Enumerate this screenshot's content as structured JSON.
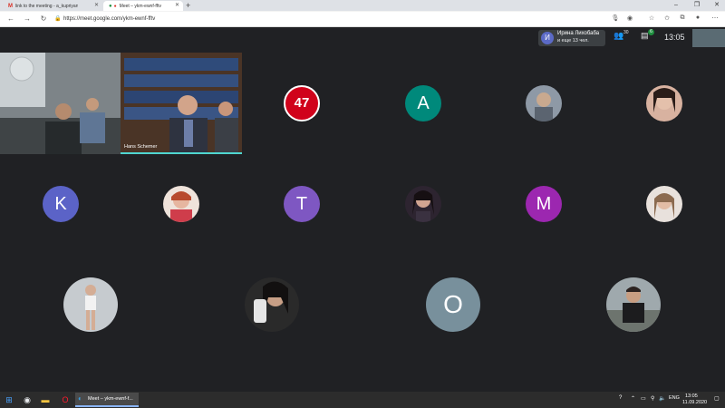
{
  "browser": {
    "tabs": [
      {
        "label": "link to the meeting - a_kupriyan",
        "icon": "gmail-icon"
      },
      {
        "label": "Meet – ykm-ewnf-fftv",
        "icon": "meet-icon",
        "active": true
      }
    ],
    "new_tab": "+",
    "url": "https://meet.google.com/ykm-ewnf-fftv",
    "window_controls": [
      "–",
      "❐",
      "✕"
    ]
  },
  "meet": {
    "presenter": {
      "initial": "И",
      "name": "Ирина Лихобаба",
      "others": "и еще 13 чел."
    },
    "participants_count": "30",
    "chat_badge": "6",
    "clock": "13:05",
    "tiles": [
      {
        "name": "",
        "type": "video"
      },
      {
        "name": "Hans Schemer",
        "type": "video"
      },
      {
        "label": "47",
        "type": "badge",
        "color": "#d0021b"
      },
      {
        "label": "A",
        "type": "initial",
        "color": "#00897b"
      },
      {
        "type": "photo"
      },
      {
        "type": "photo"
      },
      {
        "label": "K",
        "type": "initial",
        "color": "#5b63c7"
      },
      {
        "type": "photo"
      },
      {
        "label": "T",
        "type": "initial",
        "color": "#7e57c2"
      },
      {
        "type": "photo"
      },
      {
        "label": "M",
        "type": "initial",
        "color": "#9c27b0"
      },
      {
        "type": "photo"
      },
      {
        "type": "photo"
      },
      {
        "type": "photo"
      },
      {
        "label": "O",
        "type": "initial",
        "color": "#78909c"
      },
      {
        "type": "photo"
      }
    ]
  },
  "taskbar": {
    "app_label": "Meet – ykm-ewnf-f...",
    "lang": "ENG",
    "time": "13:05",
    "date": "11.09.2020"
  }
}
